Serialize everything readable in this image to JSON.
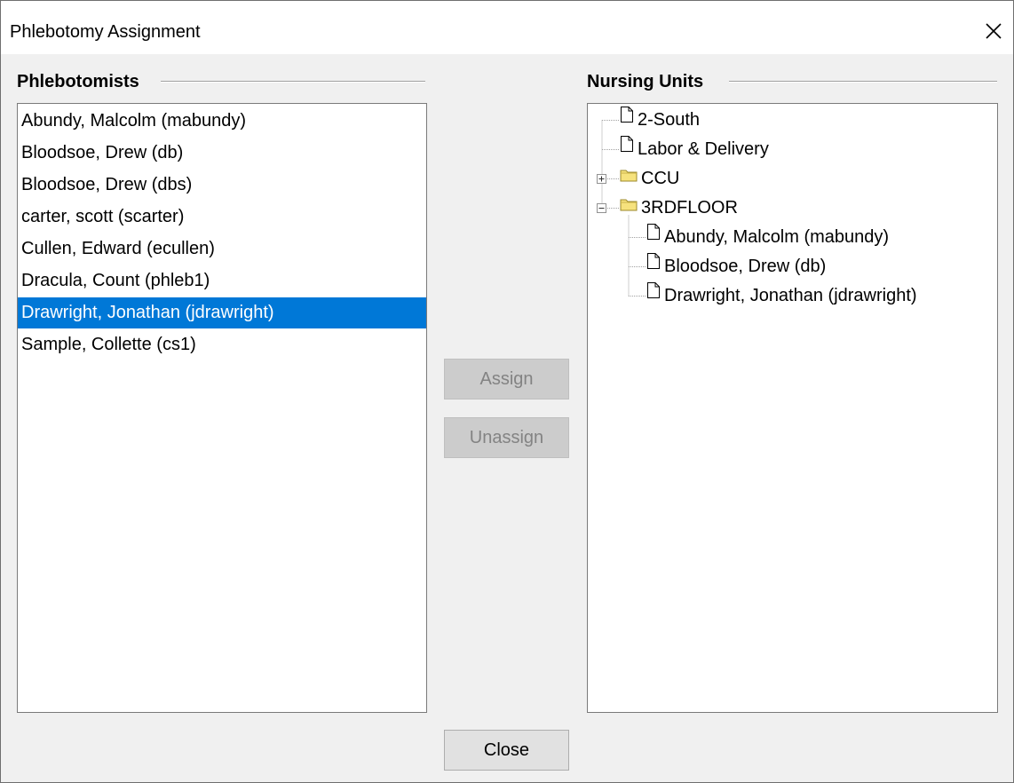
{
  "window": {
    "title": "Phlebotomy Assignment",
    "close_icon": "close-icon"
  },
  "phlebotomists": {
    "label": "Phlebotomists",
    "items": [
      "Abundy, Malcolm (mabundy)",
      "Bloodsoe, Drew (db)",
      "Bloodsoe, Drew (dbs)",
      "carter, scott (scarter)",
      "Cullen, Edward (ecullen)",
      "Dracula, Count (phleb1)",
      "Drawright, Jonathan (jdrawright)",
      "Sample, Collette (cs1)"
    ],
    "selected_index": 6
  },
  "actions": {
    "assign_label": "Assign",
    "unassign_label": "Unassign",
    "assign_enabled": false,
    "unassign_enabled": false,
    "close_label": "Close"
  },
  "nursing_units": {
    "label": "Nursing Units",
    "nodes": [
      {
        "label": "2-South",
        "icon": "document-icon",
        "level": 0,
        "expander": "none"
      },
      {
        "label": "Labor & Delivery",
        "icon": "document-icon",
        "level": 0,
        "expander": "none"
      },
      {
        "label": "CCU",
        "icon": "folder-icon",
        "level": 0,
        "expander": "collapsed"
      },
      {
        "label": "3RDFLOOR",
        "icon": "folder-icon",
        "level": 0,
        "expander": "expanded"
      },
      {
        "label": "Abundy, Malcolm (mabundy)",
        "icon": "document-icon",
        "level": 1,
        "expander": "none"
      },
      {
        "label": "Bloodsoe, Drew (db)",
        "icon": "document-icon",
        "level": 1,
        "expander": "none"
      },
      {
        "label": "Drawright, Jonathan (jdrawright)",
        "icon": "document-icon",
        "level": 1,
        "expander": "none"
      }
    ]
  },
  "colors": {
    "selection": "#0078d7",
    "dialog_background": "#f0f0f0",
    "folder": "#f6e27d"
  }
}
